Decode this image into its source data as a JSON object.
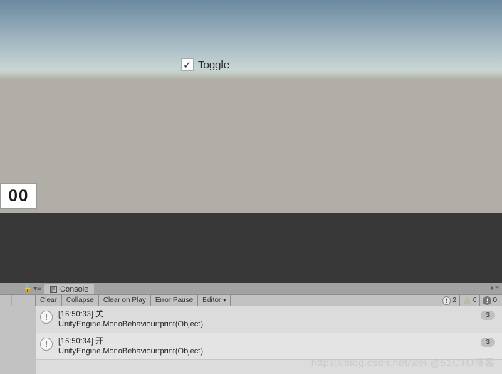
{
  "game": {
    "toggle_label": "Toggle",
    "number_display": "00"
  },
  "tabs": {
    "console_label": "Console",
    "lock_glyph": "🔒",
    "menu_glyph": "▾≡",
    "right_glyph": "∗≡"
  },
  "toolbar": {
    "clear": "Clear",
    "collapse": "Collapse",
    "clear_on_play": "Clear on Play",
    "error_pause": "Error Pause",
    "editor": "Editor"
  },
  "counts": {
    "info": "2",
    "warn": "0",
    "error": "0"
  },
  "logs": [
    {
      "line1": "[16:50:33] 关",
      "line2": "UnityEngine.MonoBehaviour:print(Object)",
      "badge": "3"
    },
    {
      "line1": "[16:50:34] 开",
      "line2": "UnityEngine.MonoBehaviour:print(Object)",
      "badge": "3"
    }
  ],
  "watermark": "https://blog.csdn.net/wei @51CTO博客"
}
